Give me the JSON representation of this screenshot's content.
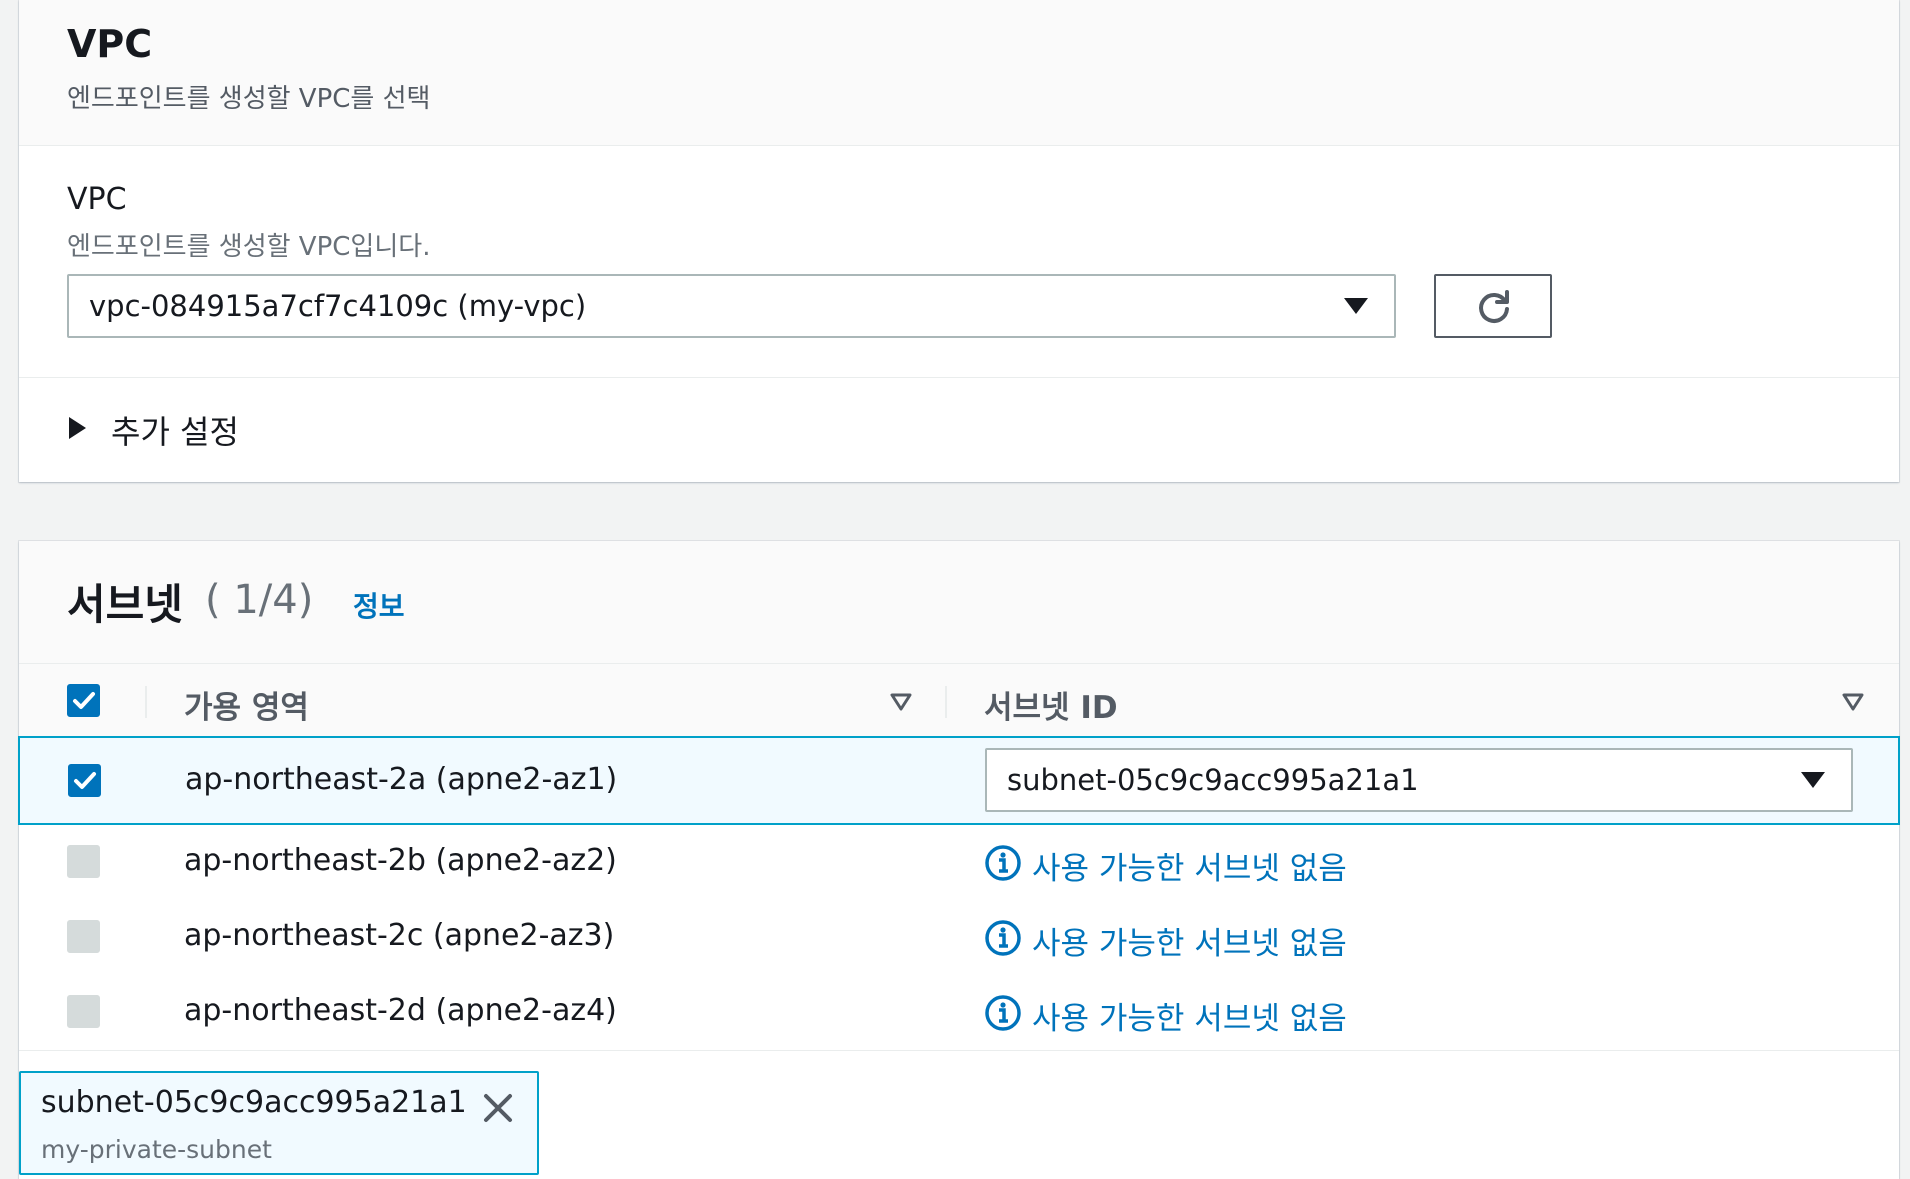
{
  "vpc_section": {
    "title": "VPC",
    "description": "엔드포인트를 생성할 VPC를 선택",
    "field_label": "VPC",
    "field_description": "엔드포인트를 생성할 VPC입니다.",
    "selected_vpc": "vpc-084915a7cf7c4109c (my-vpc)",
    "refresh_icon": "refresh-icon",
    "extra_settings_label": "추가 설정"
  },
  "subnets": {
    "title": "서브넷",
    "count": "( 1/4)",
    "info_link": "정보",
    "columns": {
      "availability_zone": "가용 영역",
      "subnet_id": "서브넷 ID"
    },
    "rows": [
      {
        "az": "ap-northeast-2a (apne2-az1)",
        "checked": true,
        "subnet": "subnet-05c9c9acc995a21a1"
      },
      {
        "az": "ap-northeast-2b (apne2-az2)",
        "checked": false,
        "subnet_message": "사용 가능한 서브넷 없음"
      },
      {
        "az": "ap-northeast-2c (apne2-az3)",
        "checked": false,
        "subnet_message": "사용 가능한 서브넷 없음"
      },
      {
        "az": "ap-northeast-2d (apne2-az4)",
        "checked": false,
        "subnet_message": "사용 가능한 서브넷 없음"
      }
    ],
    "selected_token": {
      "id": "subnet-05c9c9acc995a21a1",
      "name": "my-private-subnet"
    }
  },
  "colors": {
    "accent": "#0073bb",
    "selected_border": "#00a1c9",
    "selected_bg": "#f1faff"
  }
}
